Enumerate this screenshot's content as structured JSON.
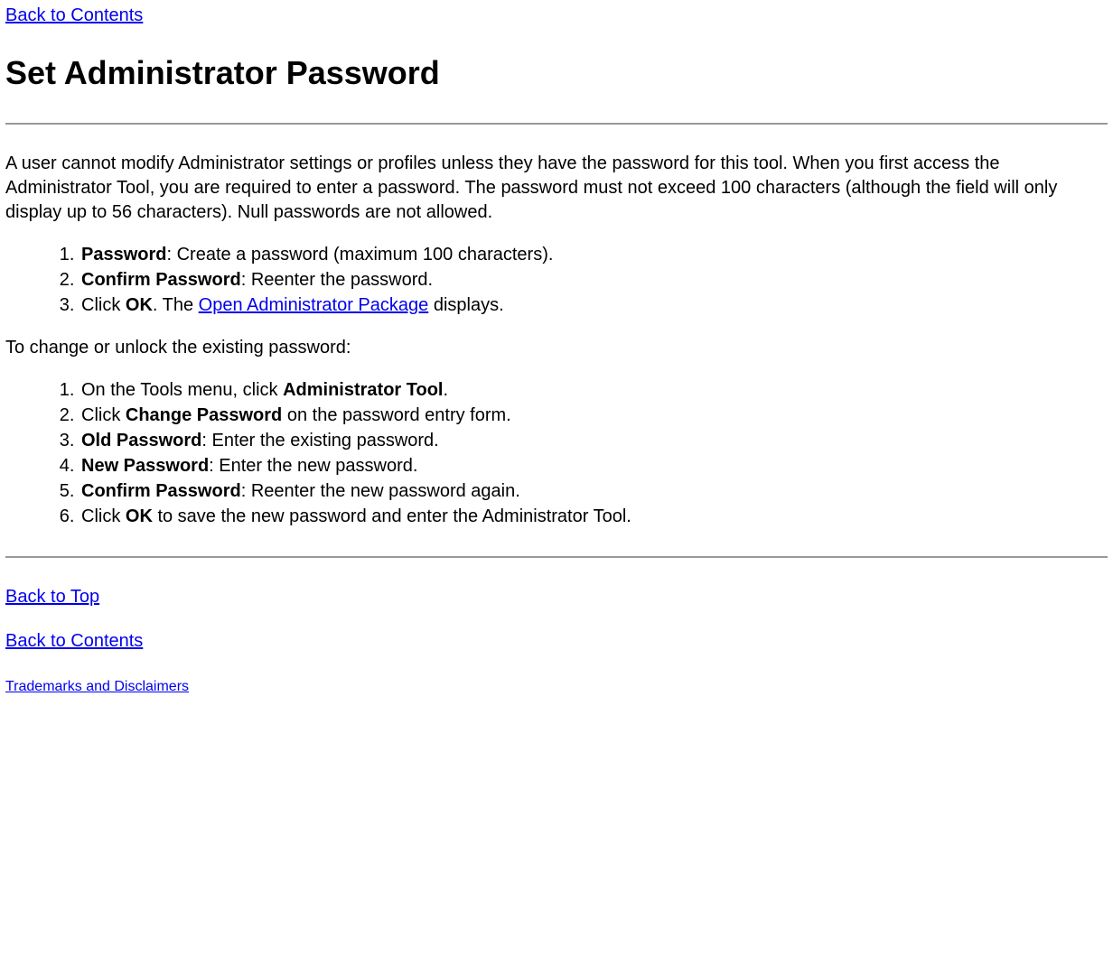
{
  "links": {
    "back_to_contents_top": "Back to Contents",
    "open_admin_package": "Open Administrator Package",
    "back_to_top": "Back to Top",
    "back_to_contents_bottom": "Back to Contents",
    "trademarks": "Trademarks and Disclaimers"
  },
  "heading": "Set Administrator Password",
  "intro": "A user cannot modify Administrator settings or profiles unless they have the password for this tool. When you first access the Administrator Tool, you are required to enter a password. The password must not exceed 100 characters (although the field will only display up to 56 characters). Null passwords are not allowed.",
  "list1": {
    "i1_bold": "Password",
    "i1_rest": ": Create a password (maximum 100 characters).",
    "i2_bold": "Confirm Password",
    "i2_rest": ": Reenter the password.",
    "i3_pre": "Click ",
    "i3_bold": "OK",
    "i3_mid": ". The ",
    "i3_post": " displays."
  },
  "subhead": "To change or unlock the existing password:",
  "list2": {
    "i1_pre": "On the Tools menu, click ",
    "i1_bold": "Administrator Tool",
    "i1_post": ".",
    "i2_pre": "Click ",
    "i2_bold": "Change Password",
    "i2_post": " on the password entry form.",
    "i3_bold": "Old Password",
    "i3_rest": ": Enter the existing password.",
    "i4_bold": "New Password",
    "i4_rest": ": Enter the new password.",
    "i5_bold": "Confirm Password",
    "i5_rest": ": Reenter the new password again.",
    "i6_pre": "Click ",
    "i6_bold": "OK",
    "i6_post": " to save the new password and enter the Administrator Tool."
  }
}
